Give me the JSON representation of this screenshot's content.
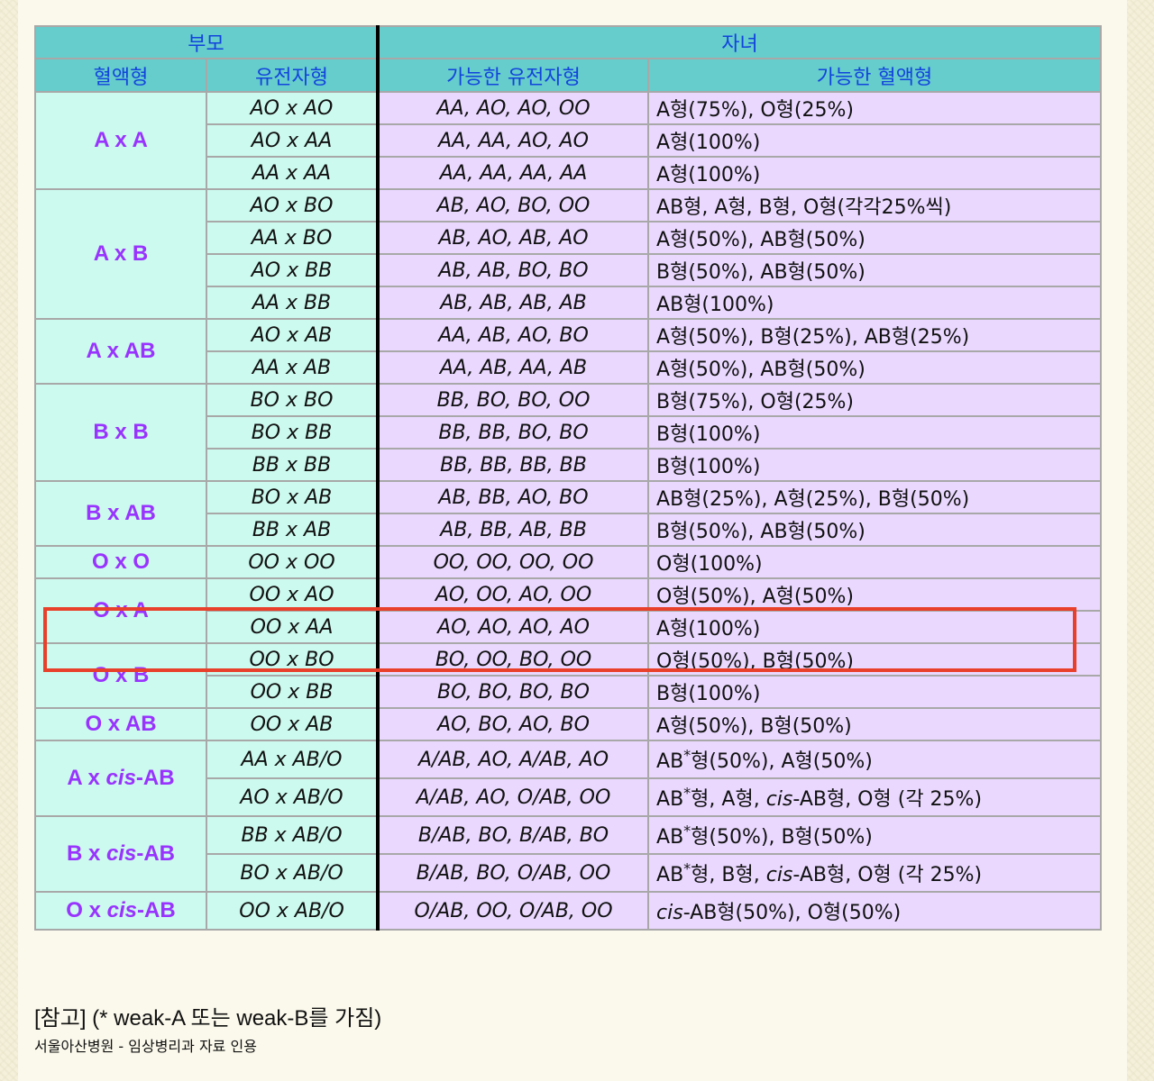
{
  "header": {
    "parents": "부모",
    "children": "자녀",
    "col_blood": "혈액형",
    "col_genotype": "유전자형",
    "col_possible_genotype": "가능한 유전자형",
    "col_possible_blood": "가능한 혈액형"
  },
  "groups": [
    {
      "blood": "A x A",
      "rows": [
        {
          "genotype": "AO x AO",
          "possible_genotypes": "AA, AO, AO, OO",
          "possible_blood": "A형(75%), O형(25%)"
        },
        {
          "genotype": "AO x AA",
          "possible_genotypes": "AA, AA, AO, AO",
          "possible_blood": "A형(100%)"
        },
        {
          "genotype": "AA x AA",
          "possible_genotypes": "AA, AA, AA, AA",
          "possible_blood": "A형(100%)"
        }
      ]
    },
    {
      "blood": "A x B",
      "rows": [
        {
          "genotype": "AO x BO",
          "possible_genotypes": "AB, AO, BO, OO",
          "possible_blood": "AB형, A형, B형, O형(각각25%씩)"
        },
        {
          "genotype": "AA x BO",
          "possible_genotypes": "AB, AO, AB, AO",
          "possible_blood": "A형(50%), AB형(50%)"
        },
        {
          "genotype": "AO x BB",
          "possible_genotypes": "AB, AB, BO, BO",
          "possible_blood": "B형(50%), AB형(50%)"
        },
        {
          "genotype": "AA x BB",
          "possible_genotypes": "AB, AB, AB, AB",
          "possible_blood": "AB형(100%)"
        }
      ]
    },
    {
      "blood": "A x AB",
      "rows": [
        {
          "genotype": "AO x AB",
          "possible_genotypes": "AA, AB, AO, BO",
          "possible_blood": "A형(50%), B형(25%), AB형(25%)"
        },
        {
          "genotype": "AA x AB",
          "possible_genotypes": "AA, AB, AA, AB",
          "possible_blood": "A형(50%), AB형(50%)"
        }
      ]
    },
    {
      "blood": "B x B",
      "rows": [
        {
          "genotype": "BO x BO",
          "possible_genotypes": "BB, BO, BO, OO",
          "possible_blood": "B형(75%), O형(25%)"
        },
        {
          "genotype": "BO x BB",
          "possible_genotypes": "BB, BB, BO, BO",
          "possible_blood": "B형(100%)"
        },
        {
          "genotype": "BB x BB",
          "possible_genotypes": "BB, BB, BB, BB",
          "possible_blood": "B형(100%)"
        }
      ]
    },
    {
      "blood": "B x AB",
      "rows": [
        {
          "genotype": "BO x AB",
          "possible_genotypes": "AB, BB, AO, BO",
          "possible_blood": "AB형(25%), A형(25%), B형(50%)"
        },
        {
          "genotype": "BB x AB",
          "possible_genotypes": "AB, BB, AB, BB",
          "possible_blood": "B형(50%), AB형(50%)"
        }
      ]
    },
    {
      "blood": "O x O",
      "rows": [
        {
          "genotype": "OO x OO",
          "possible_genotypes": "OO, OO, OO, OO",
          "possible_blood": "O형(100%)"
        }
      ]
    },
    {
      "blood": "O x A",
      "rows": [
        {
          "genotype": "OO x AO",
          "possible_genotypes": "AO, OO, AO, OO",
          "possible_blood": "O형(50%), A형(50%)"
        },
        {
          "genotype": "OO x AA",
          "possible_genotypes": "AO, AO, AO, AO",
          "possible_blood": "A형(100%)"
        }
      ]
    },
    {
      "blood": "O x B",
      "rows": [
        {
          "genotype": "OO x BO",
          "possible_genotypes": "BO, OO, BO, OO",
          "possible_blood": "O형(50%), B형(50%)"
        },
        {
          "genotype": "OO x BB",
          "possible_genotypes": "BO, BO, BO, BO",
          "possible_blood": "B형(100%)"
        }
      ]
    },
    {
      "blood": "O x AB",
      "rows": [
        {
          "genotype": "OO x AB",
          "possible_genotypes": "AO, BO, AO, BO",
          "possible_blood": "A형(50%), B형(50%)"
        }
      ]
    },
    {
      "blood_pre": "A x ",
      "blood_it": "cis",
      "blood_post": "-AB",
      "rows": [
        {
          "genotype": "AA x AB/O",
          "possible_genotypes": "A/AB, AO, A/AB, AO",
          "pb": [
            "AB",
            "*",
            "형(50%), A형(50%)",
            "",
            ""
          ]
        },
        {
          "genotype": "AO x AB/O",
          "possible_genotypes": "A/AB, AO, O/AB, OO",
          "pb": [
            "AB",
            "*",
            "형, A형, ",
            "cis",
            "-AB형, O형 (각 25%)"
          ]
        }
      ]
    },
    {
      "blood_pre": "B x ",
      "blood_it": "cis",
      "blood_post": "-AB",
      "rows": [
        {
          "genotype": "BB x AB/O",
          "possible_genotypes": "B/AB, BO, B/AB, BO",
          "pb": [
            "AB",
            "*",
            "형(50%), B형(50%)",
            "",
            ""
          ]
        },
        {
          "genotype": "BO x AB/O",
          "possible_genotypes": "B/AB, BO, O/AB, OO",
          "pb": [
            "AB",
            "*",
            "형, B형, ",
            "cis",
            "-AB형, O형 (각 25%)"
          ]
        }
      ]
    },
    {
      "blood_pre": "O x ",
      "blood_it": "cis",
      "blood_post": "-AB",
      "rows": [
        {
          "genotype": "OO x AB/O",
          "possible_genotypes": "O/AB, OO, O/AB, OO",
          "pb": [
            "",
            "",
            "",
            "cis",
            "-AB형(50%), O형(50%)"
          ]
        }
      ]
    }
  ],
  "footer": {
    "note": "[참고] (* weak-A 또는 weak-B를 가짐)",
    "source": "서울아산병원 - 임상병리과 자료 인용"
  },
  "colors": {
    "header_bg": "#66cccc",
    "header_text": "#1144dd",
    "blood_text": "#9933ff",
    "left_bg": "#ccfaee",
    "right_bg": "#ead8ff",
    "highlight": "#e8402a"
  }
}
